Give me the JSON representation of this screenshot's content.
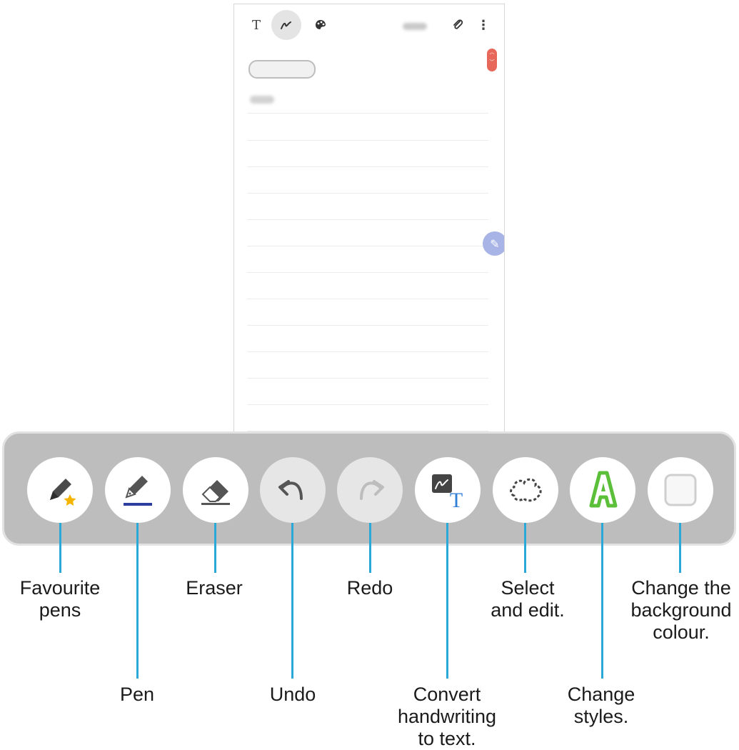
{
  "app": {
    "toolbar_icons": [
      "text-mode-icon",
      "handwriting-mode-icon",
      "palette-icon",
      "attach-icon",
      "more-icon"
    ],
    "floating_icon": "pen-icon",
    "accent_color": "#e7685a"
  },
  "pen_tools": [
    {
      "id": "favourite-pens",
      "icon": "pen-star-icon",
      "label_lines": [
        "Favourite",
        "pens"
      ]
    },
    {
      "id": "pen",
      "icon": "fountain-pen-icon",
      "label_lines": [
        "Pen"
      ]
    },
    {
      "id": "eraser",
      "icon": "eraser-icon",
      "label_lines": [
        "Eraser"
      ]
    },
    {
      "id": "undo",
      "icon": "undo-icon",
      "label_lines": [
        "Undo"
      ]
    },
    {
      "id": "redo",
      "icon": "redo-icon",
      "label_lines": [
        "Redo"
      ]
    },
    {
      "id": "convert",
      "icon": "handwriting-to-text-icon",
      "label_lines": [
        "Convert",
        "handwriting",
        "to text."
      ]
    },
    {
      "id": "select",
      "icon": "lasso-select-icon",
      "label_lines": [
        "Select",
        "and edit."
      ]
    },
    {
      "id": "styles",
      "icon": "letter-style-icon",
      "label_lines": [
        "Change",
        "styles."
      ]
    },
    {
      "id": "background",
      "icon": "background-colour-icon",
      "label_lines": [
        "Change the",
        "background",
        "colour."
      ]
    }
  ],
  "colors": {
    "leader_line": "#2aa8d8",
    "pen_underline": "#2c3e9e",
    "star": "#f4b400",
    "style_green": "#5cbf3a",
    "convert_text": "#2f7fd6"
  }
}
